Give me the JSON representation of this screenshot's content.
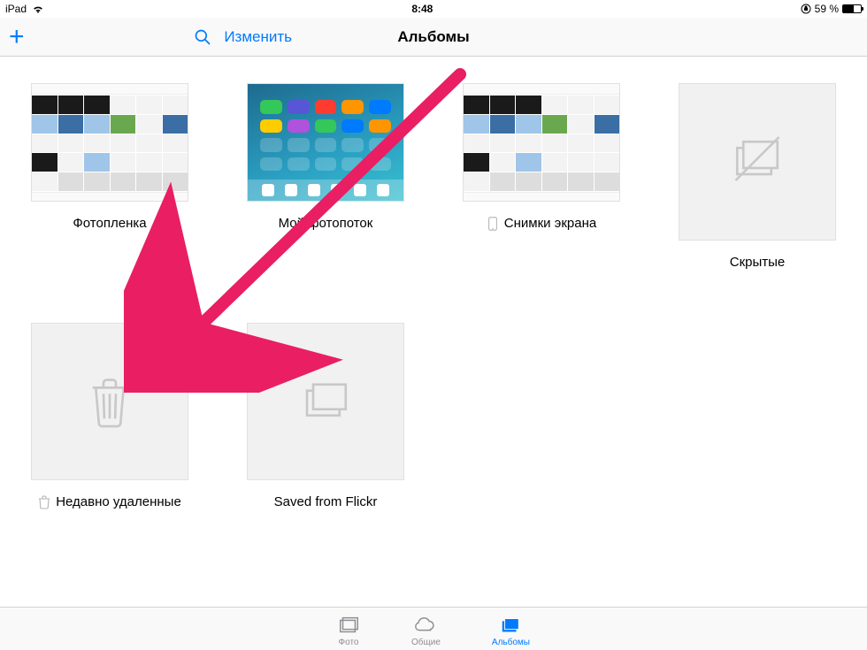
{
  "status": {
    "device": "iPad",
    "time": "8:48",
    "battery_text": "59 %",
    "battery_pct": 59
  },
  "nav": {
    "title": "Альбомы",
    "edit": "Изменить"
  },
  "albums": [
    {
      "kind": "collage",
      "label": "Фотопленка",
      "icon": null
    },
    {
      "kind": "home",
      "label": "Мой фотопоток",
      "icon": null
    },
    {
      "kind": "collage",
      "label": "Снимки экрана",
      "icon": "device"
    },
    {
      "kind": "hidden",
      "label": "Скрытые",
      "icon": null
    },
    {
      "kind": "trash",
      "label": "Недавно удаленные",
      "icon": "trash"
    },
    {
      "kind": "stack",
      "label": "Saved from Flickr",
      "icon": null
    }
  ],
  "tabs": {
    "photos": "Фото",
    "shared": "Общие",
    "albums": "Альбомы"
  },
  "colors": {
    "tint": "#007aff",
    "arrow": "#e91e63"
  }
}
